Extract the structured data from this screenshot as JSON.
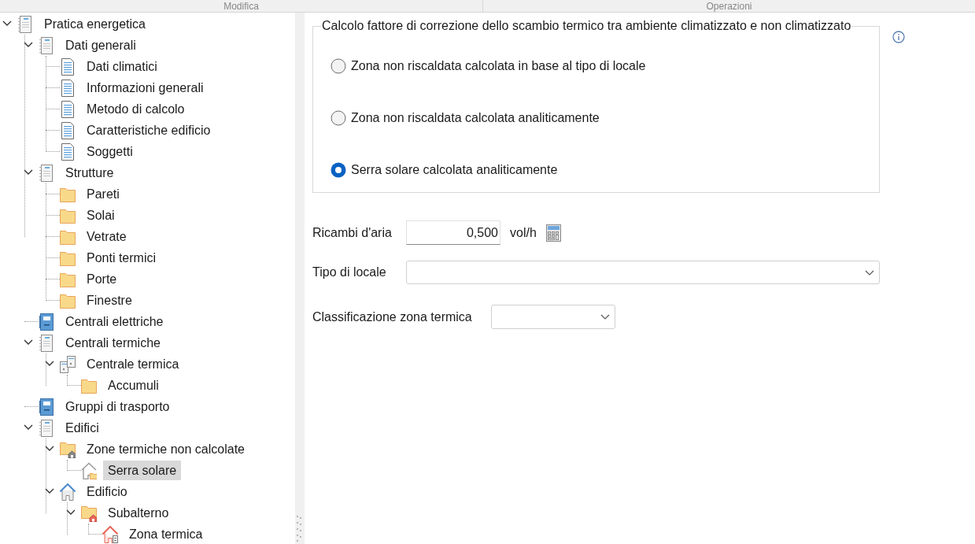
{
  "header": {
    "columns": [
      "Modifica",
      "Operazioni"
    ]
  },
  "tree": [
    {
      "label": "Pratica energetica",
      "kind": "doc-stack",
      "expanded": true,
      "selected": false,
      "children": [
        {
          "label": "Dati generali",
          "kind": "doc-stack",
          "expanded": true,
          "selected": false,
          "children": [
            {
              "label": "Dati climatici",
              "kind": "doc",
              "selected": false
            },
            {
              "label": "Informazioni generali",
              "kind": "doc",
              "selected": false
            },
            {
              "label": "Metodo di calcolo",
              "kind": "doc",
              "selected": false
            },
            {
              "label": "Caratteristiche edificio",
              "kind": "doc",
              "selected": false
            },
            {
              "label": "Soggetti",
              "kind": "doc",
              "selected": false
            }
          ]
        },
        {
          "label": "Strutture",
          "kind": "doc-stack",
          "expanded": true,
          "selected": false,
          "children": [
            {
              "label": "Pareti",
              "kind": "folder",
              "selected": false
            },
            {
              "label": "Solai",
              "kind": "folder",
              "selected": false
            },
            {
              "label": "Vetrate",
              "kind": "folder",
              "selected": false
            },
            {
              "label": "Ponti termici",
              "kind": "folder",
              "selected": false
            },
            {
              "label": "Porte",
              "kind": "folder",
              "selected": false
            },
            {
              "label": "Finestre",
              "kind": "folder",
              "selected": false
            }
          ]
        },
        {
          "label": "Centrali elettriche",
          "kind": "binder",
          "selected": false
        },
        {
          "label": "Centrali termiche",
          "kind": "doc-stack",
          "expanded": true,
          "selected": false,
          "children": [
            {
              "label": "Centrale termica",
              "kind": "server",
              "expanded": true,
              "selected": false,
              "children": [
                {
                  "label": "Accumuli",
                  "kind": "folder",
                  "selected": false
                }
              ]
            }
          ]
        },
        {
          "label": "Gruppi di trasporto",
          "kind": "binder",
          "selected": false
        },
        {
          "label": "Edifici",
          "kind": "doc-stack",
          "expanded": true,
          "selected": false,
          "children": [
            {
              "label": "Zone termiche non calcolate",
              "kind": "folder-house",
              "expanded": true,
              "selected": false,
              "children": [
                {
                  "label": "Serra solare",
                  "kind": "house-folder",
                  "selected": true
                }
              ]
            },
            {
              "label": "Edificio",
              "kind": "house",
              "expanded": true,
              "selected": false,
              "children": [
                {
                  "label": "Subalterno",
                  "kind": "folder-house-red",
                  "expanded": true,
                  "selected": false,
                  "children": [
                    {
                      "label": "Zona termica",
                      "kind": "house-red",
                      "selected": false
                    }
                  ]
                }
              ]
            }
          ]
        }
      ]
    }
  ],
  "group": {
    "title": "Calcolo fattore di correzione dello scambio termico tra ambiente climatizzato e non climatizzato",
    "options": [
      {
        "label": "Zona non riscaldata calcolata in base al tipo di locale",
        "selected": false
      },
      {
        "label": "Zona non riscaldata calcolata analiticamente",
        "selected": false
      },
      {
        "label": "Serra solare calcolata analiticamente",
        "selected": true
      }
    ]
  },
  "fields": {
    "air_changes": {
      "label": "Ricambi d'aria",
      "value": "0,500",
      "unit": "vol/h"
    },
    "room_type": {
      "label": "Tipo di locale"
    },
    "zone_class": {
      "label": "Classificazione zona termica"
    }
  }
}
